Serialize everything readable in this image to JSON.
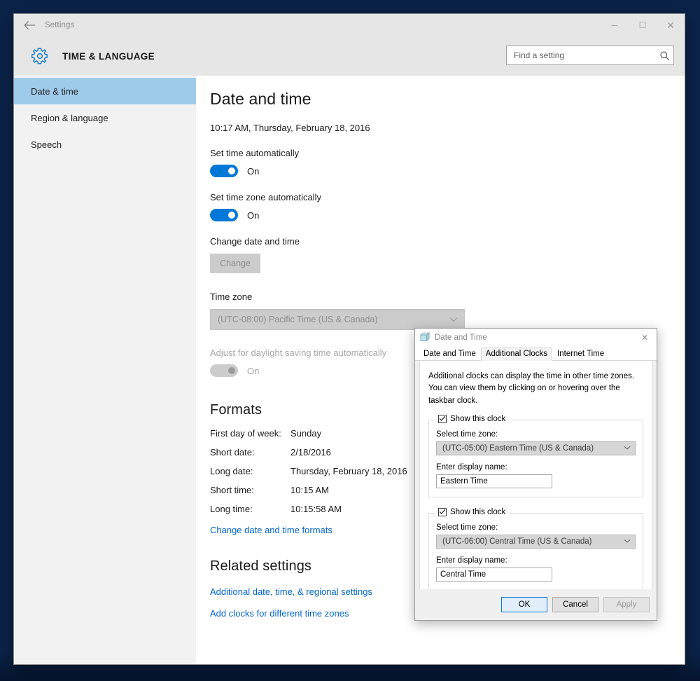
{
  "window": {
    "titlebar_text": "Settings",
    "back_icon": "back-arrow-icon",
    "minimize_label": "─",
    "maximize_label": "☐",
    "close_label": "✕",
    "app_title": "TIME & LANGUAGE",
    "gear_icon": "gear-icon"
  },
  "search": {
    "placeholder": "Find a setting",
    "value": "",
    "icon": "search-icon"
  },
  "sidebar": {
    "items": [
      {
        "label": "Date & time",
        "selected": true
      },
      {
        "label": "Region & language",
        "selected": false
      },
      {
        "label": "Speech",
        "selected": false
      }
    ]
  },
  "main": {
    "heading": "Date and time",
    "current_datetime": "10:17 AM, Thursday, February 18, 2016",
    "set_time_auto": {
      "label": "Set time automatically",
      "state": "On",
      "enabled": true
    },
    "set_timezone_auto": {
      "label": "Set time zone automatically",
      "state": "On",
      "enabled": true
    },
    "change_datetime": {
      "label": "Change date and time",
      "button_label": "Change",
      "enabled": false
    },
    "timezone": {
      "label": "Time zone",
      "value": "(UTC-08:00) Pacific Time (US & Canada)",
      "enabled": false,
      "chevron": "chevron-down-icon"
    },
    "daylight_saving": {
      "label": "Adjust for daylight saving time automatically",
      "state": "On",
      "enabled": false
    },
    "formats": {
      "heading": "Formats",
      "rows": [
        {
          "key": "First day of week:",
          "value": "Sunday"
        },
        {
          "key": "Short date:",
          "value": "2/18/2016"
        },
        {
          "key": "Long date:",
          "value": "Thursday, February 18, 2016"
        },
        {
          "key": "Short time:",
          "value": "10:15 AM"
        },
        {
          "key": "Long time:",
          "value": "10:15:58 AM"
        }
      ],
      "link": "Change date and time formats"
    },
    "related": {
      "heading": "Related settings",
      "links": [
        "Additional date, time, & regional settings",
        "Add clocks for different time zones"
      ]
    }
  },
  "dialog": {
    "icon": "date-and-time-icon",
    "title": "Date and Time",
    "close_label": "✕",
    "tabs": [
      {
        "label": "Date and Time",
        "active": false
      },
      {
        "label": "Additional Clocks",
        "active": true
      },
      {
        "label": "Internet Time",
        "active": false
      }
    ],
    "intro": "Additional clocks can display the time in other time zones. You can view them by clicking on or hovering over the taskbar clock.",
    "clocks": [
      {
        "show_label": "Show this clock",
        "checked": true,
        "timezone_label": "Select time zone:",
        "timezone_value": "(UTC-05:00) Eastern Time (US & Canada)",
        "display_name_label": "Enter display name:",
        "display_name_value": "Eastern Time"
      },
      {
        "show_label": "Show this clock",
        "checked": true,
        "timezone_label": "Select time zone:",
        "timezone_value": "(UTC-06:00) Central Time (US & Canada)",
        "display_name_label": "Enter display name:",
        "display_name_value": "Central Time"
      }
    ],
    "buttons": {
      "ok": "OK",
      "cancel": "Cancel",
      "apply": "Apply"
    }
  },
  "colors": {
    "accent": "#0078d7",
    "link": "#0066cc",
    "nav_selected": "#9fcbeb",
    "header_bg": "#e6e6e6",
    "sidebar_bg": "#f2f2f2"
  }
}
